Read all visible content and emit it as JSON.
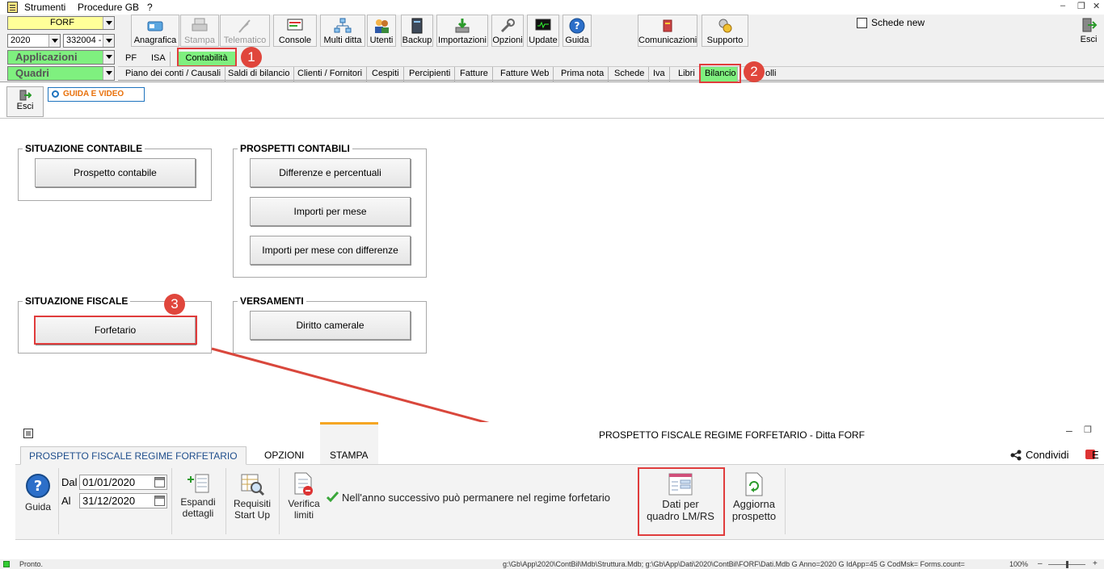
{
  "menubar": {
    "items": [
      "Strumenti",
      "Procedure GB",
      "?"
    ]
  },
  "combos": {
    "company": "FORF",
    "year": "2020",
    "code": "332004 -",
    "applicazioni": "Applicazioni",
    "quadri": "Quadri"
  },
  "toolbar": {
    "buttons": [
      {
        "label": "Anagrafica",
        "icon": "card-icon"
      },
      {
        "label": "Stampa",
        "icon": "printer-icon"
      },
      {
        "label": "Telematico",
        "icon": "feather-icon"
      },
      {
        "label": "Console",
        "icon": "console-icon"
      },
      {
        "label": "Multi ditta",
        "icon": "network-icon"
      },
      {
        "label": "Utenti",
        "icon": "users-icon"
      },
      {
        "label": "Backup",
        "icon": "backup-icon"
      },
      {
        "label": "Importazioni",
        "icon": "import-icon"
      },
      {
        "label": "Opzioni",
        "icon": "wrench-icon"
      },
      {
        "label": "Update",
        "icon": "monitor-icon"
      },
      {
        "label": "Guida",
        "icon": "help-icon"
      },
      {
        "label": "Comunicazioni",
        "icon": "megaphone-icon"
      },
      {
        "label": "Supporto",
        "icon": "support-icon"
      },
      {
        "label": "Esci",
        "icon": "exit-icon"
      }
    ],
    "schede_new": "Schede new"
  },
  "app_tabs": [
    "PF",
    "ISA",
    "Contabilità"
  ],
  "quadri_tabs": [
    "Piano dei conti / Causali",
    "Saldi di bilancio",
    "Clienti / Fornitori",
    "Cespiti",
    "Percipienti",
    "Fatture",
    "Fatture Web",
    "Prima nota",
    "Schede",
    "Iva",
    "Libri",
    "Bilancio",
    "olli"
  ],
  "badges": [
    "1",
    "2",
    "3"
  ],
  "subtoolbar": {
    "esci": "Esci",
    "guida_video": "GUIDA E VIDEO"
  },
  "groups": {
    "situazione_contabile": {
      "title": "SITUAZIONE CONTABILE",
      "buttons": [
        "Prospetto contabile"
      ]
    },
    "prospetti_contabili": {
      "title": "PROSPETTI CONTABILI",
      "buttons": [
        "Differenze e percentuali",
        "Importi per mese",
        "Importi per mese con differenze"
      ]
    },
    "situazione_fiscale": {
      "title": "SITUAZIONE FISCALE",
      "buttons": [
        "Forfetario"
      ]
    },
    "versamenti": {
      "title": "VERSAMENTI",
      "buttons": [
        "Diritto camerale"
      ]
    }
  },
  "bottom_window": {
    "title": "PROSPETTO FISCALE REGIME FORFETARIO - Ditta FORF",
    "tabs": [
      "PROSPETTO FISCALE REGIME FORFETARIO",
      "OPZIONI",
      "STAMPA"
    ],
    "condividi": "Condividi",
    "e_label": "E",
    "ribbon": {
      "guida": "Guida",
      "dal_label": "Dal",
      "dal_value": "01/01/2020",
      "al_label": "Al",
      "al_value": "31/12/2020",
      "espandi_1": "Espandi",
      "espandi_2": "dettagli",
      "requisiti_1": "Requisiti",
      "requisiti_2": "Start Up",
      "verifica_1": "Verifica",
      "verifica_2": "limiti",
      "message": "Nell'anno successivo può permanere nel regime forfetario",
      "dati_1": "Dati per",
      "dati_2": "quadro LM/RS",
      "aggiorna_1": "Aggiorna",
      "aggiorna_2": "prospetto"
    }
  },
  "statusbar": {
    "left": "Pronto.",
    "right": "g:\\Gb\\App\\2020\\ContBil\\Mdb\\Struttura.Mdb; g:\\Gb\\App\\Dati\\2020\\ContBil\\FORF\\Dati.Mdb G  Anno=2020 G  IdApp=45 G  CodMsk= Forms.count=",
    "zoom": "100%"
  }
}
